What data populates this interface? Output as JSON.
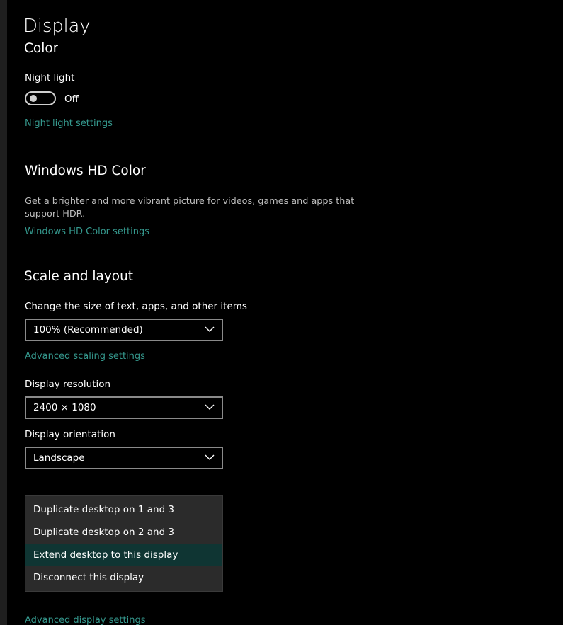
{
  "page": {
    "title": "Display",
    "cut_section_title": "Color"
  },
  "color_section": {
    "night_light_label": "Night light",
    "night_light_state": "Off",
    "night_light_on": false,
    "night_light_settings_link": "Night light settings"
  },
  "hd_color_section": {
    "heading": "Windows HD Color",
    "description": "Get a brighter and more vibrant picture for videos, games and apps that support HDR.",
    "settings_link": "Windows HD Color settings"
  },
  "scale_section": {
    "heading": "Scale and layout",
    "scale_label": "Change the size of text, apps, and other items",
    "scale_value": "100% (Recommended)",
    "advanced_scaling_link": "Advanced scaling settings",
    "resolution_label": "Display resolution",
    "resolution_value": "2400 × 1080",
    "orientation_label": "Display orientation",
    "orientation_value": "Landscape"
  },
  "multiple_displays_menu": {
    "options": [
      "Duplicate desktop on 1 and 3",
      "Duplicate desktop on 2 and 3",
      "Extend desktop to this display",
      "Disconnect this display"
    ],
    "selected_index": 2
  },
  "footer": {
    "advanced_display_link": "Advanced display settings"
  },
  "colors": {
    "background": "#000000",
    "accent_link": "#35998e",
    "selected_menu": "#0f3533"
  }
}
